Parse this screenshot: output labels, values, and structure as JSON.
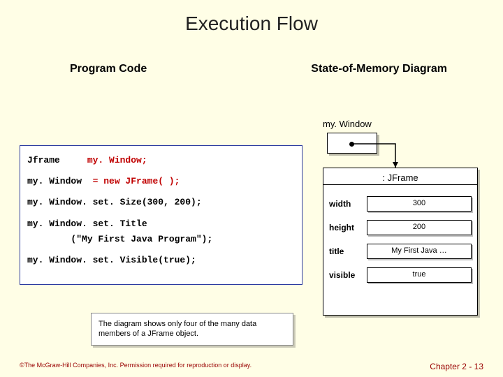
{
  "title": "Execution Flow",
  "left_heading": "Program Code",
  "right_heading": "State-of-Memory Diagram",
  "var_label": "my. Window",
  "code": {
    "l1a": "Jframe     ",
    "l1b": "my. Window;",
    "l2a": "my. Window  ",
    "l2b": "= new JFrame( );",
    "l3": "my. Window. set. Size(300, 200);",
    "l4a": "my. Window. set. Title",
    "l4b": "        (\"My First Java Program\");",
    "l5": "my. Window. set. Visible(true);"
  },
  "object": {
    "header": ": JFrame",
    "rows": [
      {
        "label": "width",
        "value": "300"
      },
      {
        "label": "height",
        "value": "200"
      },
      {
        "label": "title",
        "value": "My First Java …"
      },
      {
        "label": "visible",
        "value": "true"
      }
    ]
  },
  "caption": "The diagram shows only four of the many data members of a JFrame object.",
  "footer_left": "©The McGraw-Hill Companies, Inc. Permission required for reproduction or display.",
  "footer_right": "Chapter 2 - 13"
}
